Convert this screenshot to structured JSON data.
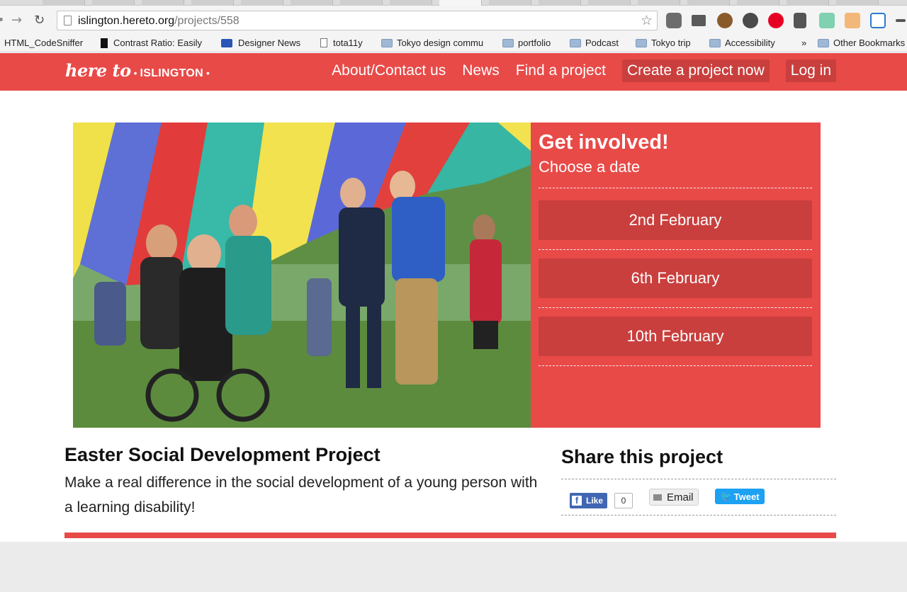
{
  "browser": {
    "url_host": "islington.hereto.org",
    "url_path": "/projects/558",
    "bookmarks": [
      {
        "label": "HTML_CodeSniffer"
      },
      {
        "label": "Contrast Ratio: Easily"
      },
      {
        "label": "Designer News"
      },
      {
        "label": "tota11y"
      },
      {
        "label": "Tokyo design commu"
      },
      {
        "label": "portfolio"
      },
      {
        "label": "Podcast"
      },
      {
        "label": "Tokyo trip"
      },
      {
        "label": "Accessibility"
      },
      {
        "label": "»"
      },
      {
        "label": "Other Bookmarks"
      }
    ]
  },
  "site": {
    "logo_script": "here to",
    "logo_place": "ISLINGTON",
    "nav": {
      "about": "About/Contact us",
      "news": "News",
      "find": "Find a project",
      "create": "Create a project now",
      "login": "Log in"
    },
    "brand_color": "#e84a48",
    "accent_dark": "#c93f3d"
  },
  "panel": {
    "title": "Get involved!",
    "subtitle": "Choose a date",
    "dates": [
      "2nd February",
      "6th February",
      "10th February"
    ]
  },
  "project": {
    "title": "Easter Social Development Project",
    "description": "Make a real difference in the social development of a young person with a learning disability!"
  },
  "share": {
    "title": "Share this project",
    "like_label": "Like",
    "like_count": "0",
    "email_label": "Email",
    "tweet_label": "Tweet"
  }
}
